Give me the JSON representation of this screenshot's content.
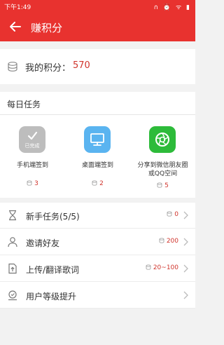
{
  "status": {
    "time": "下午1:49",
    "icons": "∩ ⏰ ᯤ ▮"
  },
  "appbar": {
    "title": "赚积分"
  },
  "points": {
    "label": "我的积分：",
    "value": "570"
  },
  "daily": {
    "title": "每日任务",
    "tasks": [
      {
        "name": "手机端签到",
        "reward": "3",
        "done_label": "已完成",
        "tile_color": "#bdbdbd"
      },
      {
        "name": "桌面端签到",
        "reward": "2",
        "tile_color": "#5ab4f0"
      },
      {
        "name_line1": "分享到微信朋友圈",
        "name_line2": "或QQ空间",
        "reward": "5",
        "tile_color": "#2dbb3a"
      }
    ]
  },
  "list": [
    {
      "label": "新手任务(5/5)",
      "reward": "0"
    },
    {
      "label": "邀请好友",
      "reward": "200"
    },
    {
      "label": "上传/翻译歌词",
      "reward": "20~100"
    },
    {
      "label": "用户等级提升",
      "reward": ""
    }
  ],
  "colors": {
    "brand": "#e8322f",
    "accent_text": "#d0342c"
  }
}
